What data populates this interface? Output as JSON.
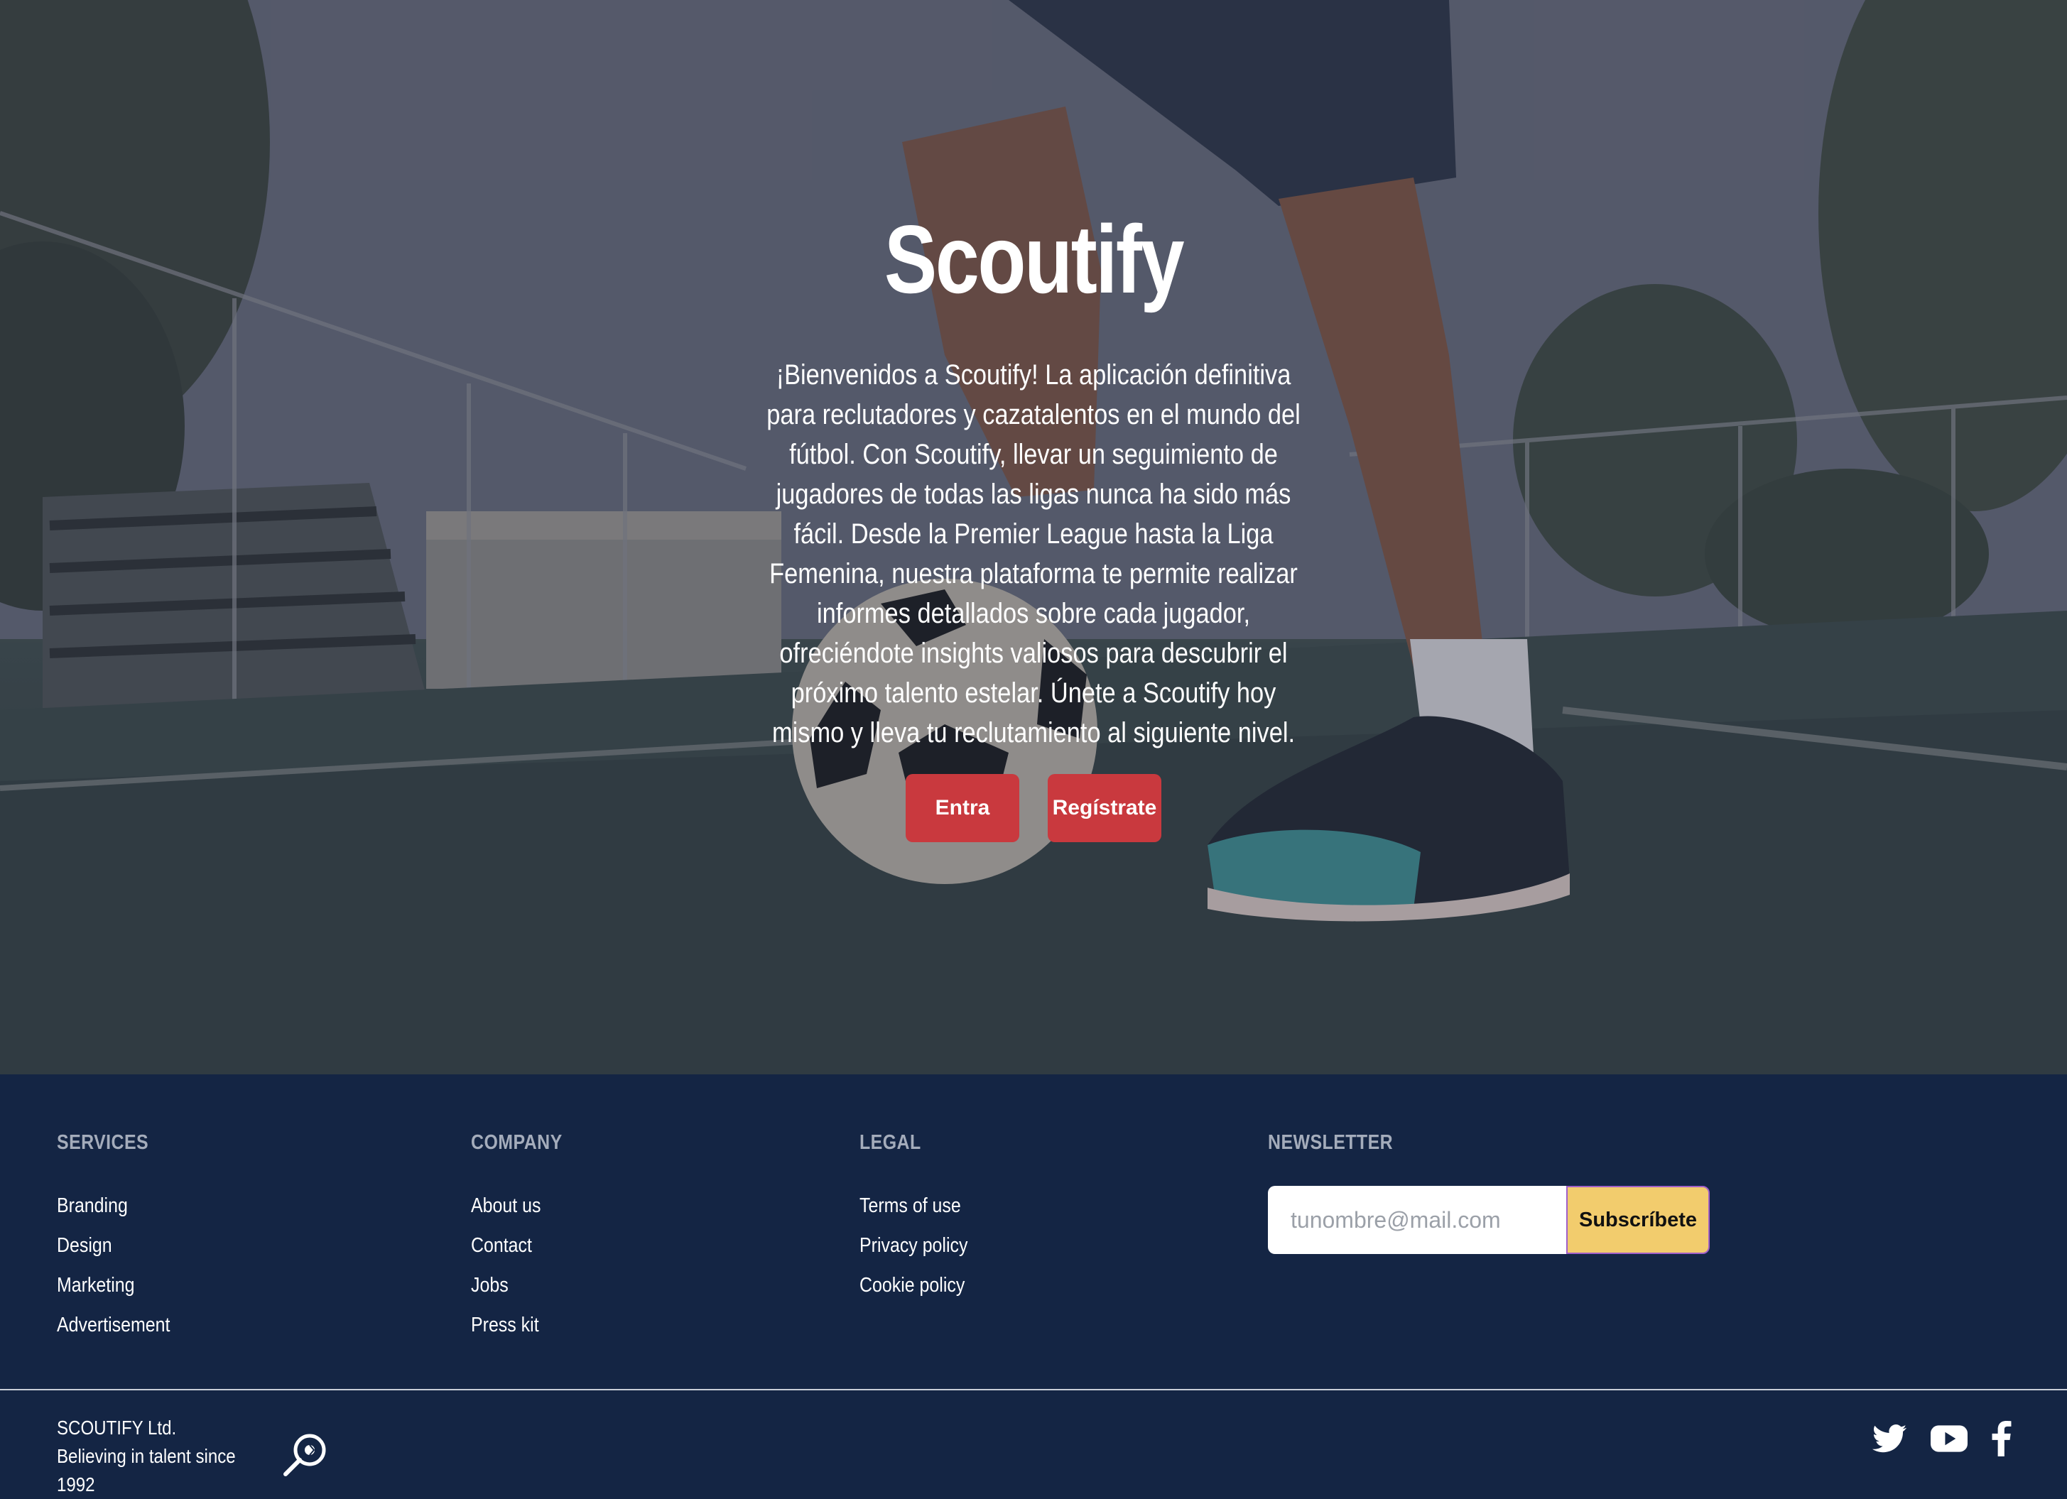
{
  "hero": {
    "title": "Scoutify",
    "description": "¡Bienvenidos a Scoutify! La aplicación definitiva para reclutadores y cazatalentos en el mundo del fútbol. Con Scoutify, llevar un seguimiento de jugadores de todas las ligas nunca ha sido más fácil. Desde la Premier League hasta la Liga Femenina, nuestra plataforma te permite realizar informes detallados sobre cada jugador, ofreciéndote insights valiosos para descubrir el próximo talento estelar. Únete a Scoutify hoy mismo y lleva tu reclutamiento al siguiente nivel.",
    "login_label": "Entra",
    "register_label": "Regístrate"
  },
  "footer": {
    "services": {
      "heading": "SERVICES",
      "items": [
        "Branding",
        "Design",
        "Marketing",
        "Advertisement"
      ]
    },
    "company": {
      "heading": "COMPANY",
      "items": [
        "About us",
        "Contact",
        "Jobs",
        "Press kit"
      ]
    },
    "legal": {
      "heading": "LEGAL",
      "items": [
        "Terms of use",
        "Privacy policy",
        "Cookie policy"
      ]
    },
    "newsletter": {
      "heading": "NEWSLETTER",
      "placeholder": "tunombre@mail.com",
      "button_label": "Subscríbete"
    },
    "company_name": "SCOUTIFY Ltd.",
    "tagline": "Believing in talent since 1992",
    "social_icons": [
      "twitter-icon",
      "youtube-icon",
      "facebook-icon"
    ]
  },
  "colors": {
    "footer_bg": "#142544",
    "button_red": "#c9393e",
    "subscribe_yellow": "#f2cc6d",
    "heading_grey": "#a4acbb"
  }
}
